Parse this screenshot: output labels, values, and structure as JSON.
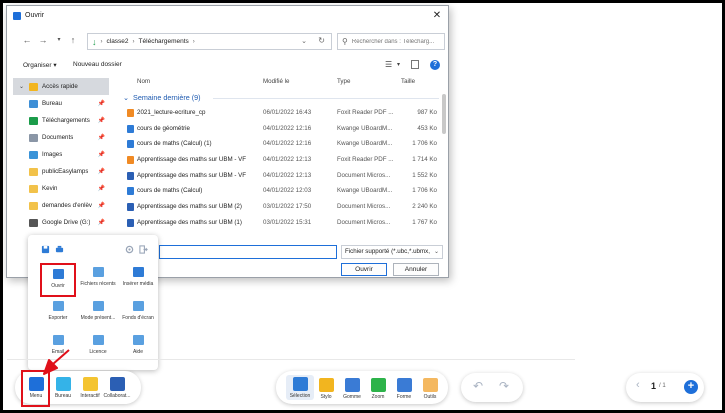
{
  "dialog": {
    "title": "Ouvrir",
    "address": [
      "classe2",
      "Téléchargements"
    ],
    "search_placeholder": "Rechercher dans : Télécharg...",
    "toolbar": {
      "organize": "Organiser ▾",
      "new_folder": "Nouveau dossier"
    },
    "sidebar": [
      {
        "label": "Accès rapide",
        "icon": "star-icon",
        "color": "#f2b51f",
        "active": true
      },
      {
        "label": "Bureau",
        "icon": "desktop-icon",
        "color": "#3e8fd6"
      },
      {
        "label": "Téléchargements",
        "icon": "download-icon",
        "color": "#1b9c4a"
      },
      {
        "label": "Documents",
        "icon": "document-icon",
        "color": "#8a96a6"
      },
      {
        "label": "Images",
        "icon": "image-icon",
        "color": "#3a93d8"
      },
      {
        "label": "publicEasylamps",
        "icon": "folder-icon",
        "color": "#f2c24a"
      },
      {
        "label": "Kevin",
        "icon": "folder-icon",
        "color": "#f2c24a"
      },
      {
        "label": "demandes d'enlèv",
        "icon": "folder-icon",
        "color": "#f2c24a"
      },
      {
        "label": "Google Drive (G:)",
        "icon": "drive-icon",
        "color": "#555555"
      }
    ],
    "columns": {
      "name": "Nom",
      "modified": "Modifié le",
      "type": "Type",
      "size": "Taille"
    },
    "group_label": "Semaine dernière (9)",
    "files": [
      {
        "name": "2021_lecture-ecriture_cp",
        "date": "06/01/2022 16:43",
        "type": "Foxit Reader PDF ...",
        "size": "987 Ko",
        "icon": "pdf-icon",
        "color": "#f08a24"
      },
      {
        "name": "cours de géométrie",
        "date": "04/01/2022 12:16",
        "type": "Kwange UBoardM...",
        "size": "453 Ko",
        "icon": "ubm-icon",
        "color": "#2e7bd6"
      },
      {
        "name": "cours de maths (Calcul) (1)",
        "date": "04/01/2022 12:16",
        "type": "Kwange UBoardM...",
        "size": "1 706 Ko",
        "icon": "ubm-icon",
        "color": "#2e7bd6"
      },
      {
        "name": "Apprentissage des maths sur UBM - VF",
        "date": "04/01/2022 12:13",
        "type": "Foxit Reader PDF ...",
        "size": "1 714 Ko",
        "icon": "pdf-icon",
        "color": "#f08a24"
      },
      {
        "name": "Apprentissage des maths sur UBM - VF",
        "date": "04/01/2022 12:13",
        "type": "Document Micros...",
        "size": "1 552 Ko",
        "icon": "word-icon",
        "color": "#2b5fb4"
      },
      {
        "name": "cours de maths (Calcul)",
        "date": "04/01/2022 12:03",
        "type": "Kwange UBoardM...",
        "size": "1 706 Ko",
        "icon": "ubm-icon",
        "color": "#2e7bd6"
      },
      {
        "name": "Apprentissage des maths sur UBM (2)",
        "date": "03/01/2022 17:50",
        "type": "Document Micros...",
        "size": "2 240 Ko",
        "icon": "word-icon",
        "color": "#2b5fb4"
      },
      {
        "name": "Apprentissage des maths sur UBM (1)",
        "date": "03/01/2022 15:31",
        "type": "Document Micros...",
        "size": "1 767 Ko",
        "icon": "word-icon",
        "color": "#2b5fb4"
      }
    ],
    "filter": "Fichier supporté (*.ubc,*.ubmx,",
    "open_label": "Ouvrir",
    "cancel_label": "Annuler"
  },
  "menu": {
    "items": [
      {
        "label": "Ouvrir",
        "icon": "folder-open-icon",
        "color": "#2e7bd6",
        "highlight": true
      },
      {
        "label": "Fichiers récents",
        "icon": "recent-files-icon",
        "color": "#5aa0e0"
      },
      {
        "label": "Insérer média",
        "icon": "media-icon",
        "color": "#2e7bd6"
      },
      {
        "label": "Exporter",
        "icon": "export-icon",
        "color": "#5aa0e0"
      },
      {
        "label": "Mode présent...",
        "icon": "presentation-icon",
        "color": "#5aa0e0"
      },
      {
        "label": "Fonds d'écran",
        "icon": "wallpaper-icon",
        "color": "#5aa0e0"
      },
      {
        "label": "Email",
        "icon": "email-icon",
        "color": "#5aa0e0"
      },
      {
        "label": "Licence",
        "icon": "license-icon",
        "color": "#5aa0e0"
      },
      {
        "label": "Aide",
        "icon": "help-icon",
        "color": "#5aa0e0"
      }
    ]
  },
  "bottombar": {
    "left": [
      {
        "label": "Menu",
        "icon": "menu-icon",
        "color": "#1e6fd9"
      },
      {
        "label": "Bureau",
        "icon": "desktop-icon",
        "color": "#34b3e8"
      },
      {
        "label": "Interactif",
        "icon": "interactive-icon",
        "color": "#f4c431"
      },
      {
        "label": "Collaborat...",
        "icon": "collaboration-icon",
        "color": "#2b5fb4"
      }
    ],
    "tools": [
      {
        "label": "Sélection",
        "icon": "cursor-icon",
        "color": "#2e7bd6"
      },
      {
        "label": "Stylo",
        "icon": "pen-icon",
        "color": "#f2b51f"
      },
      {
        "label": "Gomme",
        "icon": "eraser-icon",
        "color": "#3a7bd5"
      },
      {
        "label": "Zoom",
        "icon": "zoom-icon",
        "color": "#2db34a"
      },
      {
        "label": "Forme",
        "icon": "shape-icon",
        "color": "#3a7bd5"
      },
      {
        "label": "Outils",
        "icon": "tools-icon",
        "color": "#f4b860"
      }
    ],
    "page_current": "1",
    "page_total": "/ 1"
  }
}
